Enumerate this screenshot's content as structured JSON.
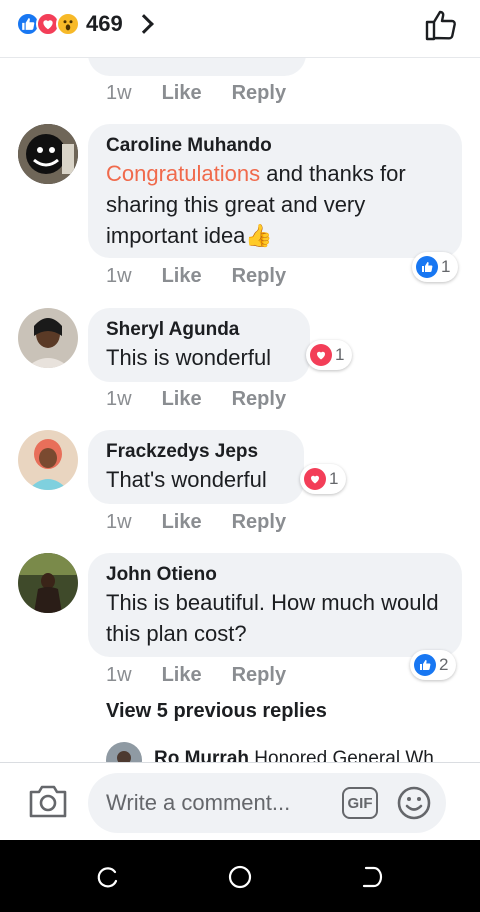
{
  "header": {
    "reaction_count": "469",
    "reaction_icons": [
      "like-icon",
      "love-icon",
      "wow-icon"
    ]
  },
  "comments": [
    {
      "author": "",
      "text": "",
      "time": "1w",
      "like_label": "Like",
      "reply_label": "Reply"
    },
    {
      "author": "Caroline Muhando",
      "text_highlight": "Congratulations",
      "text_rest": " and thanks for sharing this great and very important idea",
      "emoji": "👍",
      "time": "1w",
      "like_label": "Like",
      "reply_label": "Reply",
      "reaction": {
        "icon": "like-icon",
        "count": "1"
      }
    },
    {
      "author": "Sheryl Agunda",
      "text": "This is wonderful",
      "time": "1w",
      "like_label": "Like",
      "reply_label": "Reply",
      "reaction": {
        "icon": "love-icon",
        "count": "1"
      }
    },
    {
      "author": "Frackzedys Jeps",
      "text": "That's wonderful",
      "time": "1w",
      "like_label": "Like",
      "reply_label": "Reply",
      "reaction": {
        "icon": "love-icon",
        "count": "1"
      }
    },
    {
      "author": "John Otieno",
      "text": "This is beautiful. How much would this plan cost?",
      "time": "1w",
      "like_label": "Like",
      "reply_label": "Reply",
      "reaction": {
        "icon": "like-icon",
        "count": "2"
      }
    }
  ],
  "replies": {
    "view_previous_label": "View 5 previous replies",
    "peek_author": "Ro Murrah",
    "peek_text": "Honored General Wh"
  },
  "composer": {
    "placeholder": "Write a comment...",
    "gif_label": "GIF"
  },
  "colors": {
    "like_blue": "#1877f2",
    "love_red": "#f33e58",
    "wow_yellow": "#f7b928",
    "highlight_orange": "#f06a4c",
    "bubble_gray": "#f0f2f5"
  }
}
